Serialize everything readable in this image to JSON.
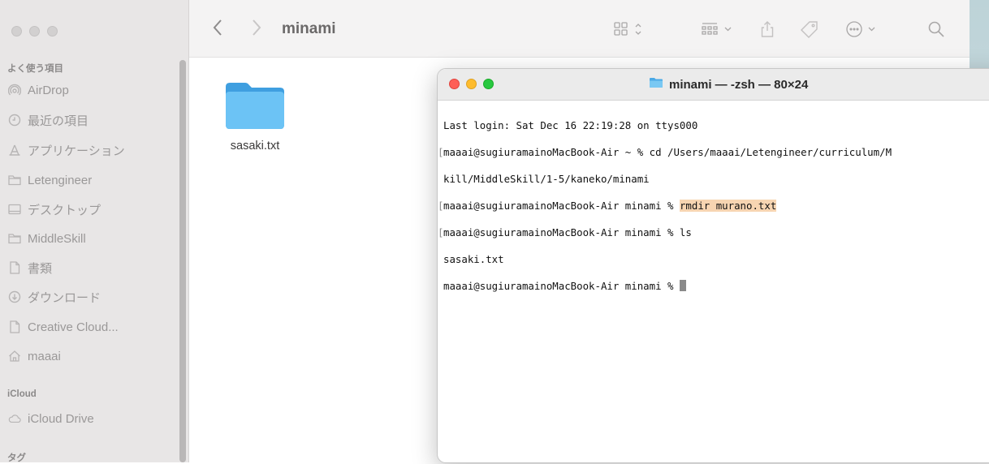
{
  "finder": {
    "folder_title": "minami",
    "sidebar": {
      "favorites_header": "よく使う項目",
      "items": [
        {
          "label": "AirDrop",
          "icon": "airdrop-icon"
        },
        {
          "label": "最近の項目",
          "icon": "clock-icon"
        },
        {
          "label": "アプリケーション",
          "icon": "applications-icon"
        },
        {
          "label": "Letengineer",
          "icon": "folder-icon"
        },
        {
          "label": "デスクトップ",
          "icon": "desktop-icon"
        },
        {
          "label": "MiddleSkill",
          "icon": "folder-icon"
        },
        {
          "label": "書類",
          "icon": "document-icon"
        },
        {
          "label": "ダウンロード",
          "icon": "download-icon"
        },
        {
          "label": "Creative Cloud...",
          "icon": "document-icon"
        },
        {
          "label": "maaai",
          "icon": "home-icon"
        }
      ],
      "icloud_header": "iCloud",
      "icloud_items": [
        {
          "label": "iCloud Drive",
          "icon": "cloud-icon"
        }
      ],
      "tags_header": "タグ"
    },
    "files": [
      {
        "name": "sasaki.txt",
        "icon": "folder-icon"
      }
    ]
  },
  "terminal": {
    "title": "minami — -zsh — 80×24",
    "lines": [
      {
        "text": "Last login: Sat Dec 16 22:19:28 on ttys000",
        "bracket": false
      },
      {
        "text": "maaai@sugiuramainoMacBook-Air ~ % cd /Users/maaai/Letengineer/curriculum/M",
        "bracket": true
      },
      {
        "text": "kill/MiddleSkill/1-5/kaneko/minami",
        "bracket": false
      },
      {
        "prefix": "maaai@sugiuramainoMacBook-Air minami % ",
        "highlight": "rmdir murano.txt",
        "bracket": true
      },
      {
        "text": "maaai@sugiuramainoMacBook-Air minami % ls",
        "bracket": true
      },
      {
        "text": "sasaki.txt",
        "bracket": false
      },
      {
        "text": "maaai@sugiuramainoMacBook-Air minami % ",
        "bracket": false,
        "cursor": true
      }
    ]
  },
  "colors": {
    "terminal_highlight": "#f7d5b2",
    "close": "#fe5f57",
    "minimize": "#febc2e",
    "zoom": "#28c840",
    "folder_blue": "#5ab8f0"
  }
}
